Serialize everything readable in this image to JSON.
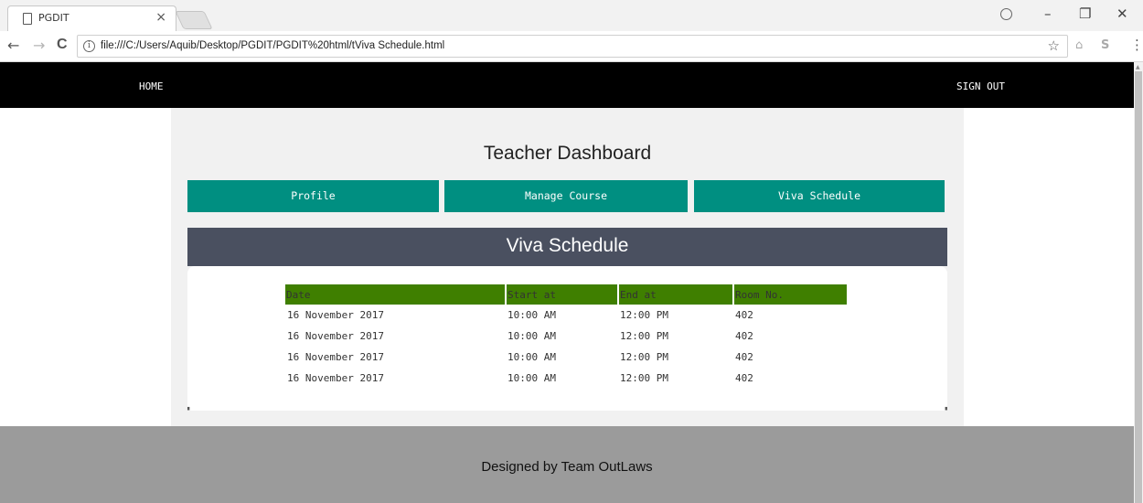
{
  "browser": {
    "tab_title": "PGDIT",
    "tab_close": "×",
    "url": "file:///C:/Users/Aquib/Desktop/PGDIT/PGDIT%20html/tViva Schedule.html",
    "info_icon": "i",
    "back": "←",
    "forward": "→",
    "reload": "C",
    "bookmark": "☆",
    "menu": "⋮",
    "minimize": "–",
    "restore": "❐",
    "close": "✕",
    "ext1": "⌂",
    "ext2": "S"
  },
  "nav": {
    "home": "HOME",
    "sign_out": "SIGN OUT"
  },
  "dashboard": {
    "title": "Teacher Dashboard",
    "buttons": [
      "Profile",
      "Manage Course",
      "Viva Schedule"
    ]
  },
  "schedule": {
    "title": "Viva Schedule",
    "columns": [
      "Date",
      "Start at",
      "End at",
      "Room No."
    ],
    "rows": [
      [
        "16 November 2017",
        "10:00 AM",
        "12:00 PM",
        "402"
      ],
      [
        "16 November 2017",
        "10:00 AM",
        "12:00 PM",
        "402"
      ],
      [
        "16 November 2017",
        "10:00 AM",
        "12:00 PM",
        "402"
      ],
      [
        "16 November 2017",
        "10:00 AM",
        "12:00 PM",
        "402"
      ]
    ]
  },
  "footer": {
    "text": "Designed by Team OutLaws"
  },
  "colors": {
    "nav_bg": "#000000",
    "button_bg": "#008f81",
    "header_bg": "#4a5060",
    "table_head_bg": "#3f7f00",
    "footer_bg": "#9b9b9b"
  }
}
